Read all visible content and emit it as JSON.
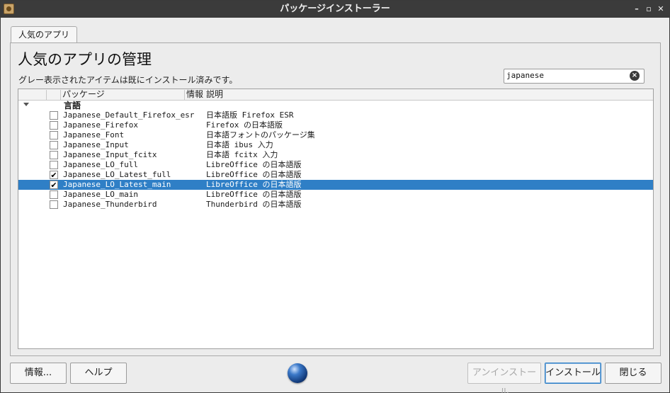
{
  "window": {
    "title": "パッケージインストーラー",
    "controls": {
      "minimize": "–",
      "maximize": "▫",
      "close": "✕"
    }
  },
  "tabs": [
    {
      "label": "人気のアプリ",
      "active": true
    }
  ],
  "main": {
    "heading": "人気のアプリの管理",
    "subtext": "グレー表示されたアイテムは既にインストール済みです。",
    "search": {
      "value": "japanese",
      "clear_icon": "×"
    }
  },
  "table": {
    "columns": {
      "package": "パッケージ",
      "info": "情報",
      "description": "説明"
    },
    "group": {
      "label": "言語",
      "expanded": true
    },
    "rows": [
      {
        "package": "Japanese_Default_Firefox_esr",
        "description": "日本語版 Firefox ESR",
        "checked": false,
        "checkmark": "",
        "selected": false
      },
      {
        "package": "Japanese_Firefox",
        "description": "Firefox の日本語版",
        "checked": false,
        "checkmark": "",
        "selected": false
      },
      {
        "package": "Japanese_Font",
        "description": "日本語フォントのパッケージ集",
        "checked": false,
        "checkmark": "",
        "selected": false
      },
      {
        "package": "Japanese_Input",
        "description": "日本語 ibus 入力",
        "checked": false,
        "checkmark": "",
        "selected": false
      },
      {
        "package": "Japanese_Input_fcitx",
        "description": "日本語 fcitx 入力",
        "checked": false,
        "checkmark": "",
        "selected": false
      },
      {
        "package": "Japanese_LO_full",
        "description": "LibreOffice の日本語版",
        "checked": false,
        "checkmark": "",
        "selected": false
      },
      {
        "package": "Japanese_LO_Latest_full",
        "description": "LibreOffice の日本語版",
        "checked": true,
        "checkmark": "✔",
        "selected": false
      },
      {
        "package": "Japanese_LO_Latest_main",
        "description": "LibreOffice の日本語版",
        "checked": true,
        "checkmark": "✔",
        "selected": true
      },
      {
        "package": "Japanese_LO_main",
        "description": "LibreOffice の日本語版",
        "checked": false,
        "checkmark": "",
        "selected": false
      },
      {
        "package": "Japanese_Thunderbird",
        "description": "Thunderbird の日本語版",
        "checked": false,
        "checkmark": "",
        "selected": false
      }
    ]
  },
  "footer": {
    "about_label": "情報...",
    "help_label": "ヘルプ",
    "uninstall_label": "アンインストール",
    "install_label": "インストール",
    "close_label": "閉じる"
  },
  "colors": {
    "selection": "#2f7fc6",
    "titlebar": "#3b3b3b"
  }
}
